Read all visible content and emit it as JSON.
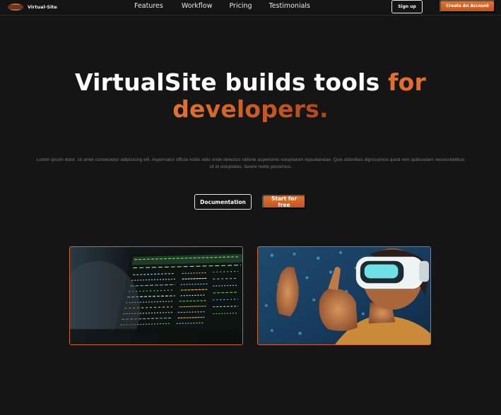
{
  "brand": {
    "name": "Virtual-Site"
  },
  "nav": {
    "links": [
      "Features",
      "Workflow",
      "Pricing",
      "Testimonials"
    ],
    "signup": "Sign up",
    "create_account": "Create An Account"
  },
  "hero": {
    "title_part1": "VirtualSite builds tools ",
    "title_accent1": "for",
    "title_accent2": "developers.",
    "description": "Lorem ipsum dolor, sit amet consectetur adipisicing elit. Aspernatur officia nobis odio unde delectus ratione asperiores voluptatum repudiandae. Quis doloribus dignissimos quod rem quibusdam necessitatibus sit id voluptates, facere nobis possimus.",
    "doc_button": "Documentation",
    "start_button": "Start for free"
  },
  "colors": {
    "accent": "#e0742f",
    "accent_dark": "#c4541b",
    "background": "#161515"
  }
}
